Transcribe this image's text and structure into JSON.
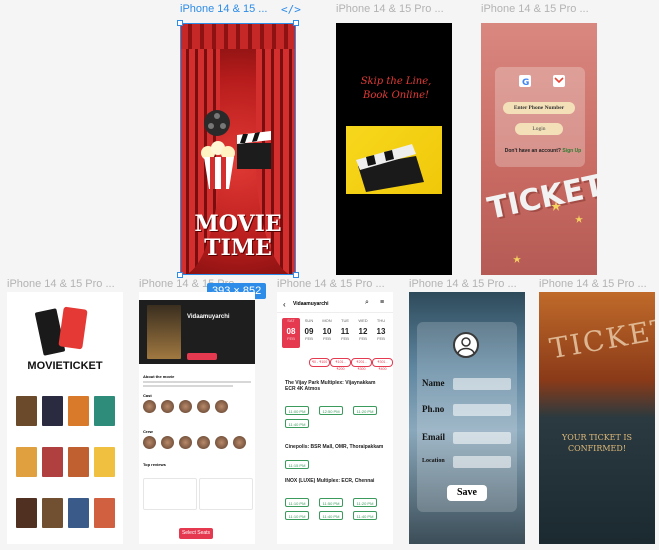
{
  "canvas": {
    "frame_labels": [
      "iPhone 14 & 15 ...",
      "iPhone 14 & 15 Pro ...",
      "iPhone 14 & 15 Pro ...",
      "iPhone 14 & 15 Pro ...",
      "iPhone 14 & 15 Pro ...",
      "iPhone 14 & 15 Pro ...",
      "iPhone 14 & 15 Pro ...",
      "iPhone 14 & 15 Pro ..."
    ],
    "code_icon": "</>",
    "selection_size": "393 × 852"
  },
  "frame1": {
    "title_line1": "MOVIE",
    "title_line2": "TIME"
  },
  "frame2": {
    "line1": "Skip the Line,",
    "line2": "Book Online!"
  },
  "frame3": {
    "phone_placeholder": "Enter Phone Number",
    "login_label": "Login",
    "signup_prompt": "Don't have an account?",
    "signup_link": "Sign Up",
    "bg_word": "TICKET"
  },
  "frame4": {
    "brand": "MOVIETICKET"
  },
  "frame5": {
    "movie_title": "Vidaamuyarchi",
    "section_about": "About the movie",
    "section_cast": "Cast",
    "section_crew": "Crew",
    "section_reviews": "Top reviews",
    "select_seats": "Select Seats"
  },
  "frame6": {
    "header_title": "Vidaamuyarchi",
    "dates": [
      {
        "day": "SAT",
        "date": "08",
        "month": "FEB",
        "selected": true
      },
      {
        "day": "SUN",
        "date": "09",
        "month": "FEB",
        "selected": false
      },
      {
        "day": "MON",
        "date": "10",
        "month": "FEB",
        "selected": false
      },
      {
        "day": "TUE",
        "date": "11",
        "month": "FEB",
        "selected": false
      },
      {
        "day": "WED",
        "date": "12",
        "month": "FEB",
        "selected": false
      },
      {
        "day": "THU",
        "date": "13",
        "month": "FEB",
        "selected": false
      }
    ],
    "filters": [
      "₹0 - ₹100",
      "₹101 - ₹200",
      "₹201 - ₹300",
      "₹301 - ₹400"
    ],
    "theatres": [
      "The Vijay Park Multiplex: Vijaynakkam ECR 4K Atmos",
      "Cinepolis: BSR Mall, OMR, Thoraipakkam",
      "INOX (LUXE) Multiplex: ECR, Chennai"
    ],
    "times_a": [
      "11:00 PM",
      "12:50 PM",
      "11:20 PM",
      "11:40 PM"
    ],
    "times_b": [
      "11:15 PM"
    ],
    "times_c": [
      "11:10 PM",
      "11:50 PM",
      "11:20 PM",
      "11:10 PM",
      "11:40 PM",
      "11:40 PM"
    ]
  },
  "frame7": {
    "label_name": "Name",
    "label_phone": "Ph.no",
    "label_email": "Email",
    "label_location": "Location",
    "save": "Save"
  },
  "frame8": {
    "bg_word": "TICKET",
    "confirm_line1": "YOUR TICKET IS",
    "confirm_line2": "CONFIRMED!"
  },
  "colors": {
    "selection": "#2d8ce8",
    "accent_red": "#e53950",
    "showtime_green": "#3a9b5c"
  }
}
